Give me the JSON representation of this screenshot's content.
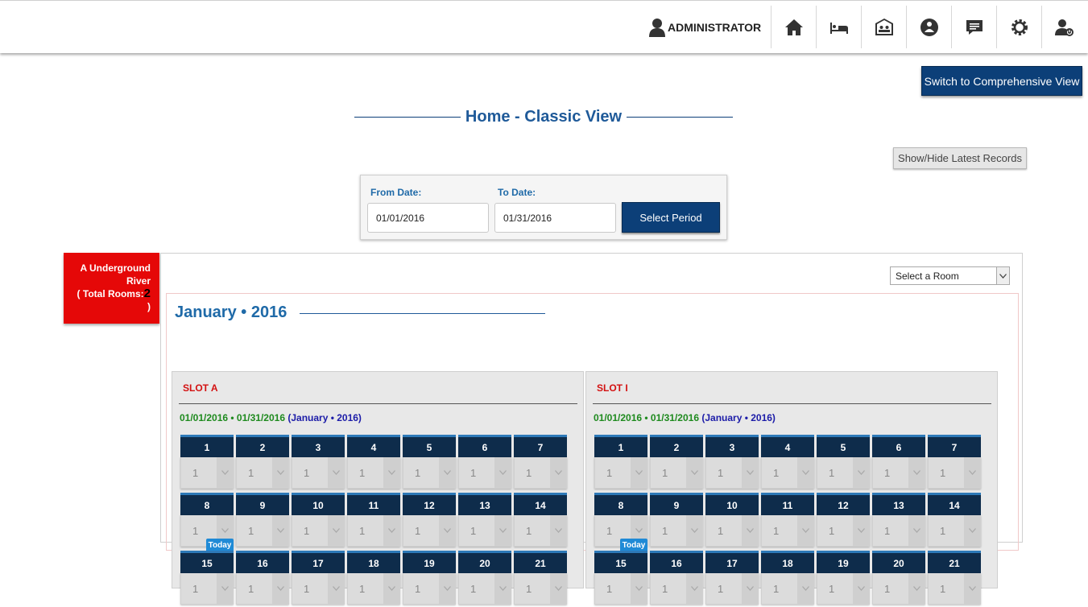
{
  "header": {
    "user_name": "ADMINISTRATOR",
    "nav_icons": [
      "home-icon",
      "bed-icon",
      "guests-icon",
      "alert-icon",
      "messages-icon",
      "settings-icon",
      "logout-icon"
    ]
  },
  "switch_view_label": "Switch to Comprehensive View",
  "page_title": "Home - Classic View",
  "show_hide_label": "Show/Hide Latest Records",
  "period": {
    "from_label": "From Date:",
    "from_value": "01/01/2016",
    "to_label": "To Date:",
    "to_value": "01/31/2016",
    "select_label": "Select Period"
  },
  "location": {
    "name": "A Underground River",
    "total_rooms_label": "( Total Rooms:",
    "total_rooms": "2",
    "close_paren": ")"
  },
  "room_select": {
    "selected": "Select a Room"
  },
  "month_title": "January • 2016",
  "slots": [
    {
      "name": "SLOT A",
      "range": "01/01/2016 • 01/31/2016",
      "period": "(January • 2016)"
    },
    {
      "name": "SLOT I",
      "range": "01/01/2016 • 01/31/2016",
      "period": "(January • 2016)"
    }
  ],
  "days_visible": [
    1,
    2,
    3,
    4,
    5,
    6,
    7,
    8,
    9,
    10,
    11,
    12,
    13,
    14,
    15,
    16,
    17,
    18,
    19,
    20,
    21
  ],
  "day_default_value": "1",
  "today_day": 8,
  "today_label": "Today",
  "colors": {
    "nav_blue": "#0c3f78",
    "day_header": "#0e2c4b",
    "alert_red": "#e50808"
  }
}
